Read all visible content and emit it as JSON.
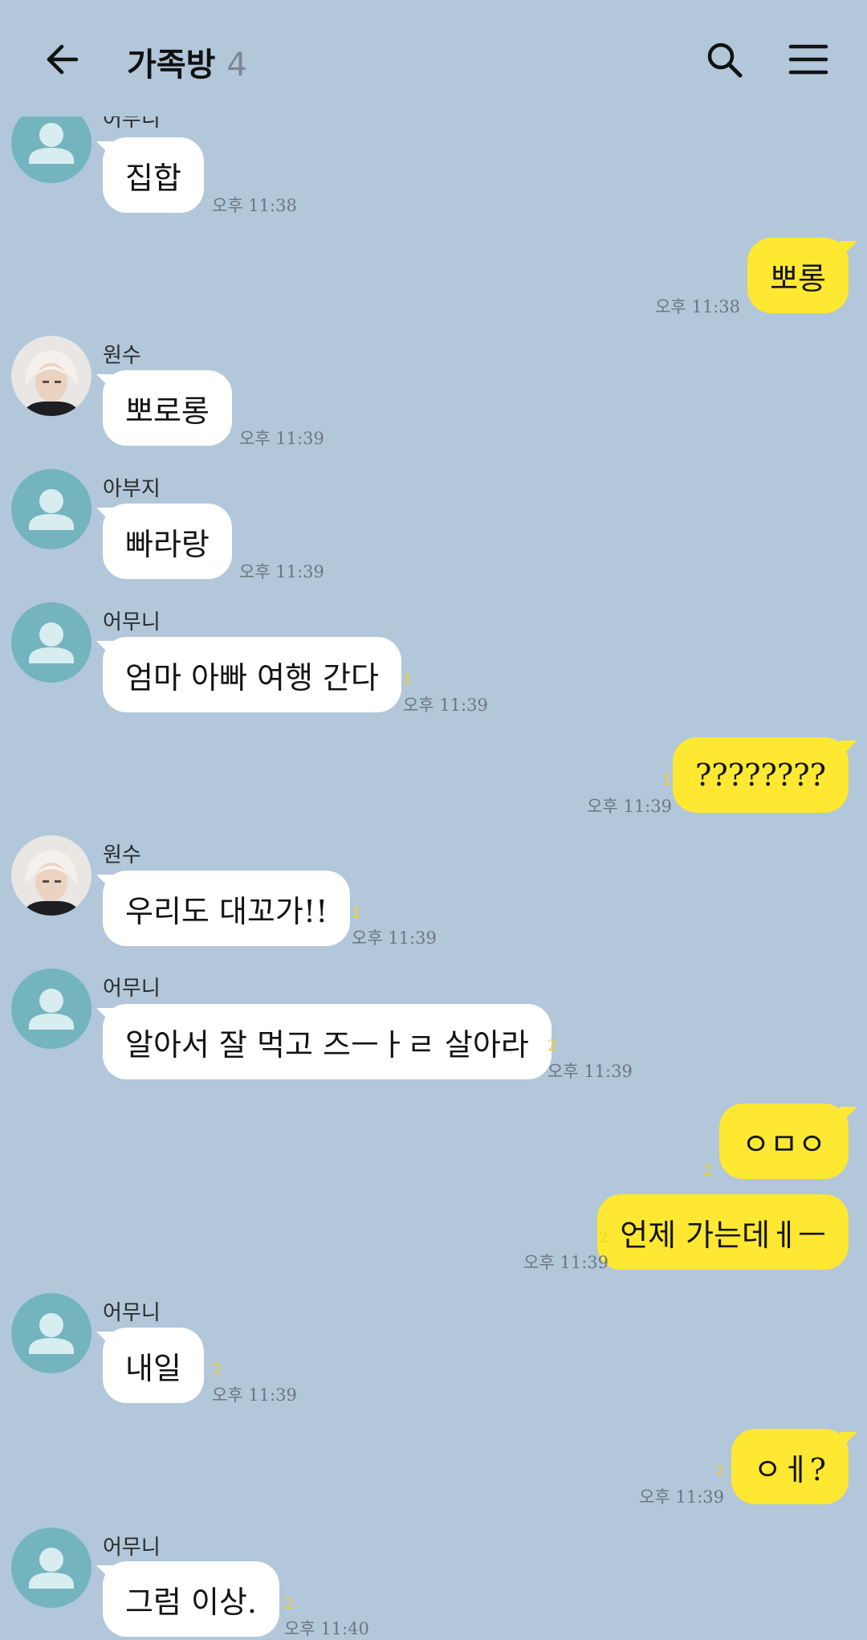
{
  "header": {
    "back_icon": "arrow-left-icon",
    "title": "가족방",
    "member_count": "4",
    "search_icon": "search-icon",
    "menu_icon": "menu-icon"
  },
  "messages": [
    {
      "sender": "어무니",
      "text": "집합",
      "time": "오후 11:38",
      "unread": ""
    },
    {
      "text": "뽀롱",
      "time": "오후 11:38",
      "unread": ""
    },
    {
      "sender": "원수",
      "text": "뽀로롱",
      "time": "오후 11:39",
      "unread": ""
    },
    {
      "sender": "아부지",
      "text": "빠라랑",
      "time": "오후 11:39",
      "unread": ""
    },
    {
      "sender": "어무니",
      "text": "엄마 아빠 여행 간다",
      "time": "오후 11:39",
      "unread": "1"
    },
    {
      "text": "????????",
      "time": "오후 11:39",
      "unread": "1"
    },
    {
      "sender": "원수",
      "text": "우리도 대꼬가!!",
      "time": "오후 11:39",
      "unread": "1"
    },
    {
      "sender": "어무니",
      "text": "알아서 잘 먹고 즈ㅡㅏㄹ 살아라",
      "time": "오후 11:39",
      "unread": "2"
    },
    {
      "text": "ㅇㅁㅇ",
      "time": "",
      "unread": "2"
    },
    {
      "text": "언제 가는데ㅔㅡ",
      "time": "오후 11:39",
      "unread": "2"
    },
    {
      "sender": "어무니",
      "text": "내일",
      "time": "오후 11:39",
      "unread": "2"
    },
    {
      "text": "ㅇㅔ?",
      "time": "오후 11:39",
      "unread": "2"
    },
    {
      "sender": "어무니",
      "text": "그럼 이상.",
      "time": "오후 11:40",
      "unread": "2"
    }
  ],
  "colors": {
    "background": "#b2c7da",
    "incoming_bubble": "#ffffff",
    "outgoing_bubble": "#fee831",
    "avatar_default": "#74b4be",
    "unread_count": "#f5d21f"
  }
}
